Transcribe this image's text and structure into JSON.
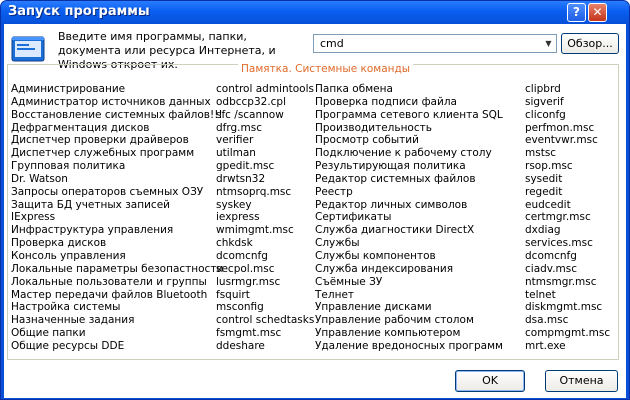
{
  "window": {
    "title": "Запуск программы",
    "help_label": "?",
    "close_label": "✕"
  },
  "prompt": "Введите имя программы, папки, документа или ресурса Интернета, и Windows откроет их.",
  "combo": {
    "value": "cmd"
  },
  "browse_label": "Обзор...",
  "memo": {
    "title": "Памятка. Системные команды",
    "col1": [
      "Администрирование",
      "Администратор источников данных",
      "Восстановление системных файлов!!!",
      "Дефрагментация дисков",
      "Диспетчер проверки драйверов",
      "Диспетчер служебных программ",
      "Групповая политика",
      "Dr. Watson",
      "Запросы операторов съемных ОЗУ",
      "Защита БД учетных записей",
      "IExpress",
      "Инфраструктура управления",
      "Проверка дисков",
      "Консоль управления",
      "Локальные параметры безопастности",
      "Локальные пользователи и группы",
      "Мастер передачи файлов Bluetooth",
      "Настройка системы",
      "Назначенные задания",
      "Общие папки",
      "Общие ресурсы DDE"
    ],
    "col2": [
      "control admintools",
      "odbccp32.cpl",
      "sfc /scannow",
      "dfrg.msc",
      "verifier",
      "utilman",
      "gpedit.msc",
      "drwtsn32",
      "ntmsoprq.msc",
      "syskey",
      "iexpress",
      "wmimgmt.msc",
      "chkdsk",
      "dcomcnfg",
      "secpol.msc",
      "lusrmgr.msc",
      "fsquirt",
      "msconfig",
      "control schedtasks",
      "fsmgmt.msc",
      "ddeshare"
    ],
    "col3": [
      "Папка обмена",
      "Проверка подписи файла",
      "Программа сетевого клиента SQL",
      "Производительность",
      "Просмотр событий",
      "Подключение к рабочему столу",
      "Результирующая политика",
      "Редактор системных файлов",
      "Реестр",
      "Редактор личных символов",
      "Сертификаты",
      "Служба диагностики DirectX",
      "Службы",
      "Службы компонентов",
      "Служба индексирования",
      "Съёмные ЗУ",
      "Телнет",
      "Управление дисками",
      "Управление рабочим столом",
      "Управление компьютером",
      "Удаление вредоносных программ"
    ],
    "col4": [
      "clipbrd",
      "sigverif",
      "cliconfg",
      "perfmon.msc",
      "eventvwr.msc",
      "mstsc",
      "rsop.msc",
      "sysedit",
      "regedit",
      "eudcedit",
      "certmgr.msc",
      "dxdiag",
      "services.msc",
      "dcomcnfg",
      "ciadv.msc",
      "ntmsmgr.msc",
      "telnet",
      "diskmgmt.msc",
      "dsa.msc",
      "compmgmt.msc",
      "mrt.exe"
    ]
  },
  "ok_label": "OK",
  "cancel_label": "Отмена",
  "icons": {
    "app": "run-app-icon",
    "dropdown": "chevron-down-icon"
  }
}
